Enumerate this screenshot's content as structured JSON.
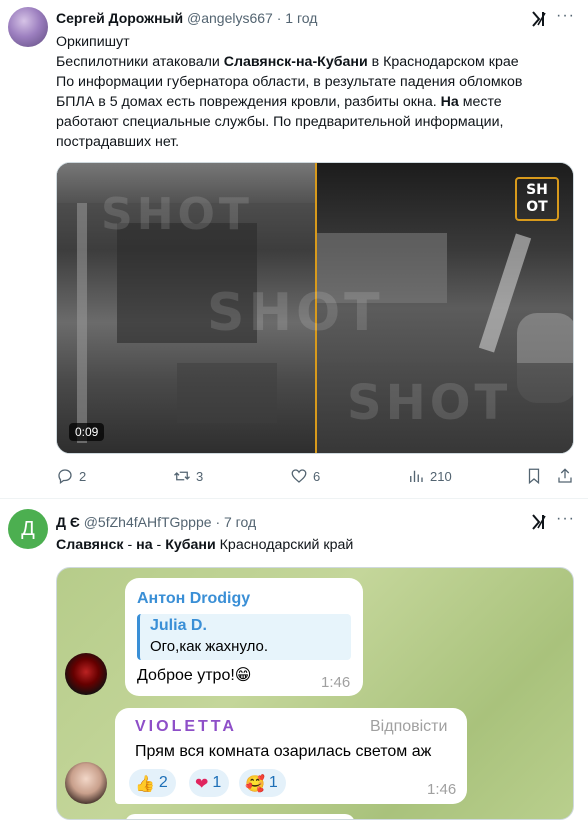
{
  "tweet1": {
    "author_name": "Сергей Дорожный",
    "handle": "@angelys667",
    "separator": "·",
    "time": "1 год",
    "lines": [
      [
        "Оркипишут"
      ],
      [
        "Беспилотники атаковали ",
        {
          "b": "Славянск-на-Кубани"
        },
        " в Краснодарском крае"
      ],
      [
        "По информации губернатора области, в результате падения обломков"
      ],
      [
        "БПЛА в 5 домах есть повреждения кровли, разбиты окна. ",
        {
          "b": "На"
        },
        " месте"
      ],
      [
        "работают специальные службы. По предварительной информации,"
      ],
      [
        "пострадавших нет."
      ]
    ],
    "video": {
      "duration": "0:09",
      "watermark": "SHOT",
      "logo_top": "SH",
      "logo_bottom": "OT"
    },
    "actions": {
      "replies": "2",
      "reposts": "3",
      "likes": "6",
      "views": "210"
    }
  },
  "tweet2": {
    "avatar_letter": "Д",
    "avatar_color": "#4caf50",
    "author_name": "Д Є",
    "handle": "@5fZh4fAHfTGpppe",
    "separator": "·",
    "time": "7 год",
    "text_parts": [
      {
        "b": "Славянск"
      },
      " - ",
      {
        "b": "на"
      },
      " - ",
      {
        "b": "Кубани"
      },
      " Краснодарский край"
    ],
    "telegram": {
      "msg1": {
        "sender": "Антон Drodigy",
        "sender_color": "#3a8fd6",
        "reply_name": "Julia D.",
        "reply_text": "Ого,как жахнуло.",
        "text": "Доброе утро!😁",
        "time": "1:46"
      },
      "msg2": {
        "sender": "VIOLETTA",
        "sender_color": "#8e4fc8",
        "reply_action": "Відповісти",
        "text": "Прям вся комната озарилась светом аж",
        "time": "1:46",
        "reactions": [
          {
            "emoji": "👍",
            "count": "2"
          },
          {
            "emoji": "❤",
            "count": "1"
          },
          {
            "emoji": "🥰",
            "count": "1"
          }
        ]
      }
    }
  },
  "colors": {
    "text": "#0f1419",
    "muted": "#536471",
    "divider": "#eff3f4",
    "video_accent": "#d89a1c"
  }
}
